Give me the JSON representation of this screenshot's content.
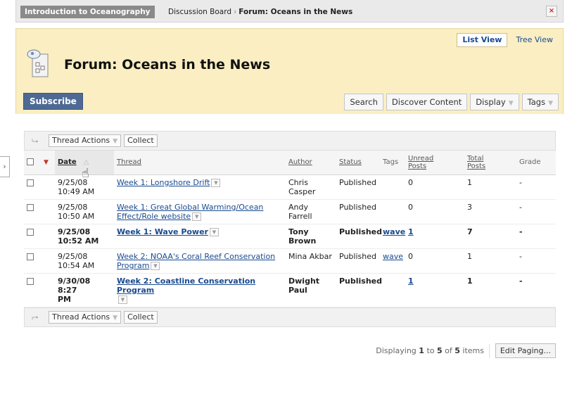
{
  "breadcrumb": {
    "course": "Introduction to Oceanography",
    "discussion_board": "Discussion Board",
    "separator": "›",
    "forum": "Forum: Oceans in the News",
    "close_icon": "×"
  },
  "header": {
    "list_view": "List View",
    "tree_view": "Tree View",
    "title": "Forum: Oceans in the News",
    "subscribe": "Subscribe",
    "buttons": [
      "Search",
      "Discover Content",
      "Display",
      "Tags"
    ]
  },
  "sidetab": {
    "glyph": "›"
  },
  "actions": {
    "thread_actions": "Thread Actions",
    "collect": "Collect"
  },
  "columns": {
    "date": "Date",
    "thread": "Thread",
    "author": "Author",
    "status": "Status",
    "tags": "Tags",
    "unread_posts_1": "Unread",
    "unread_posts_2": "Posts",
    "total_posts_1": "Total",
    "total_posts_2": "Posts",
    "grade": "Grade"
  },
  "threads": [
    {
      "date": "9/25/08",
      "time": "10:49 AM",
      "title_1": "Week 1: Longshore Drift",
      "title_2": "",
      "author_1": "Chris",
      "author_2": "Casper",
      "status": "Published",
      "tag": "",
      "unread": "0",
      "total": "1",
      "grade": "-"
    },
    {
      "date": "9/25/08",
      "time": "10:50 AM",
      "title_1": "Week 1: Great Global Warming/Ocean",
      "title_2": "Effect/Role website",
      "author_1": "Andy Farrell",
      "author_2": "",
      "status": "Published",
      "tag": "",
      "unread": "0",
      "total": "3",
      "grade": "-"
    },
    {
      "date": "9/25/08",
      "time": "10:52 AM",
      "title_1": "Week 1: Wave Power",
      "title_2": "",
      "author_1": "Tony Brown",
      "author_2": "",
      "status": "Published",
      "tag": "wave",
      "unread": "1",
      "total": "7",
      "grade": "-"
    },
    {
      "date": "9/25/08",
      "time": "10:54 AM",
      "title_1": "Week 2: NOAA's Coral Reef Conservation",
      "title_2": "Program",
      "author_1": "Mina Akbar",
      "author_2": "",
      "status": "Published",
      "tag": "wave",
      "unread": "0",
      "total": "1",
      "grade": "-"
    },
    {
      "date": "9/30/08 8:27",
      "time": "PM",
      "title_1": "Week 2: Coastline Conservation Program",
      "title_2": "",
      "author_1": "Dwight Paul",
      "author_2": "",
      "status": "Published",
      "tag": "",
      "unread": "1",
      "total": "1",
      "grade": "-"
    }
  ],
  "paging": {
    "prefix": "Displaying",
    "from": "1",
    "to_word": "to",
    "to": "5",
    "of_word": "of",
    "total": "5",
    "suffix": "items",
    "edit": "Edit Paging..."
  },
  "colors": {
    "header_bg": "#faeec2",
    "subscribe_bg": "#4e6a94",
    "link": "#1a4a8f"
  }
}
